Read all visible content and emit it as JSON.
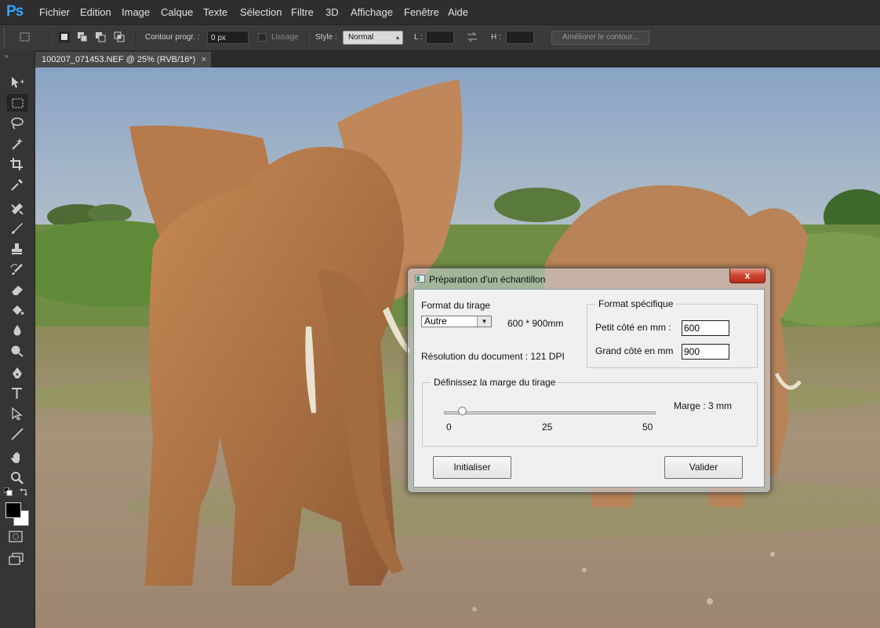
{
  "app": {
    "logo": "Ps",
    "menu": [
      "Fichier",
      "Edition",
      "Image",
      "Calque",
      "Texte",
      "Sélection",
      "Filtre",
      "3D",
      "Affichage",
      "Fenêtre",
      "Aide"
    ]
  },
  "options_bar": {
    "feather_label": "Contour progr. :",
    "feather_value": "0 px",
    "smooth_label": "Lissage",
    "style_label": "Style :",
    "style_value": "Normal",
    "width_label": "L :",
    "height_label": "H :",
    "refine_button": "Améliorer le contour..."
  },
  "document": {
    "tab_title": "100207_071453.NEF @ 25% (RVB/16*)",
    "close_glyph": "×"
  },
  "colors": {
    "foreground": "#000000",
    "background": "#ffffff",
    "accent": "#31a8ff"
  },
  "dialog": {
    "title": "Préparation d'un échantillon",
    "close_glyph": "x",
    "format_label": "Format du tirage",
    "format_value": "Autre",
    "format_size": "600 * 900mm",
    "resolution_text": "Résolution du document : 121 DPI",
    "specific_group": "Format spécifique",
    "short_side_label": "Petit côté en mm :",
    "short_side_value": "600",
    "long_side_label": "Grand côté en mm",
    "long_side_value": "900",
    "margin_group": "Définissez la marge du tirage",
    "margin_text": "Marge :  3  mm",
    "margin_value": 3,
    "slider_min": "0",
    "slider_mid": "25",
    "slider_max": "50",
    "init_button": "Initialiser",
    "validate_button": "Valider"
  }
}
